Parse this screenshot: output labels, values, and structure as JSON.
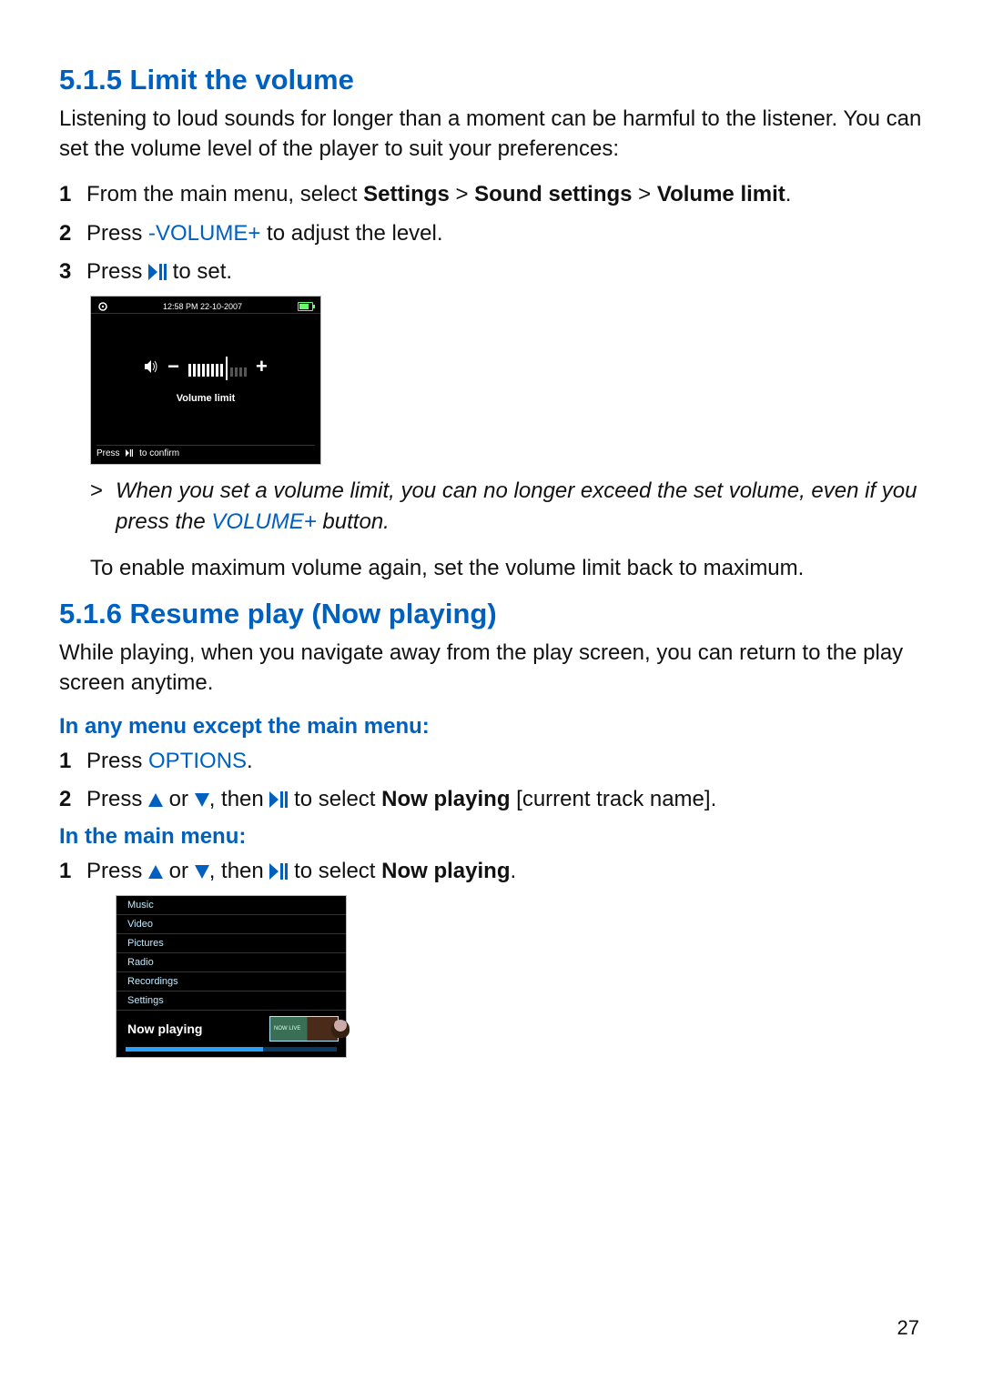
{
  "page_number": "27",
  "s515": {
    "heading": "5.1.5 Limit the volume",
    "intro": "Listening to loud sounds for longer than a moment can be harmful to the listener. You can set the volume level of the player to suit your preferences:",
    "steps": {
      "n1": "1",
      "n2": "2",
      "n3": "3",
      "s1_pre": "From the main menu, select ",
      "s1_b1": "Settings",
      "s1_gt1": " > ",
      "s1_b2": "Sound settings",
      "s1_gt2": " > ",
      "s1_b3": "Volume limit",
      "s1_end": ".",
      "s2_pre": "Press ",
      "s2_key": "-VOLUME+",
      "s2_post": " to adjust the level.",
      "s3_pre": "Press ",
      "s3_post": " to set."
    },
    "note_gt": ">",
    "note_line1": "When you set a volume limit, you can no longer exceed the set volume, even if you press the ",
    "note_key": "VOLUME+",
    "note_line1_end": " button.",
    "note_line2": "To enable maximum volume again, set the volume limit back to maximum."
  },
  "device1": {
    "time": "12:58 PM  22-10-2007",
    "label": "Volume limit",
    "footer_pre": "Press ",
    "footer_post": " to confirm"
  },
  "s516": {
    "heading": "5.1.6 Resume play (Now playing)",
    "intro": "While playing, when you navigate away from the play screen, you can return to the play screen anytime.",
    "sub1": "In any menu except the main menu:",
    "sub2": "In the main menu:",
    "steps_a": {
      "n1": "1",
      "n2": "2",
      "a1_pre": "Press ",
      "a1_key": "OPTIONS",
      "a1_end": ".",
      "a2_pre": "Press ",
      "a2_or": " or ",
      "a2_then": ", then ",
      "a2_select": " to select ",
      "a2_bold": "Now playing",
      "a2_post": " [current track name]."
    },
    "steps_b": {
      "n1": "1",
      "b1_pre": "Press ",
      "b1_or": " or ",
      "b1_then": ", then ",
      "b1_select": " to select ",
      "b1_bold": "Now playing",
      "b1_end": "."
    }
  },
  "device2": {
    "menu": [
      "Music",
      "Video",
      "Pictures",
      "Radio",
      "Recordings",
      "Settings"
    ],
    "now_playing": "Now playing",
    "thumb_text": "NOW LIVE"
  }
}
